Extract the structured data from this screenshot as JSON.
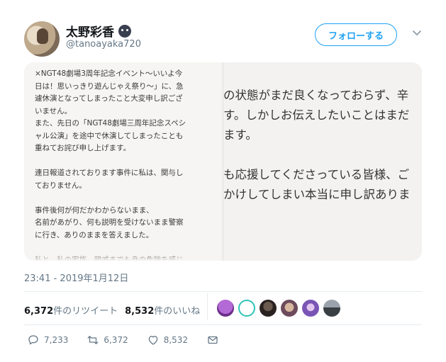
{
  "tweet": {
    "display_name": "太野彩香",
    "name_emoji_icon": "dark-mask-emoji",
    "handle": "@tanoayaka720",
    "follow_label": "フォローする",
    "timestamp": "23:41 - 2019年1月12日",
    "stats": {
      "retweets_count": "6,372",
      "retweets_label": "件のリツイート",
      "likes_count": "8,532",
      "likes_label": "件のいいね"
    },
    "actions": {
      "reply_count": "7,233",
      "retweet_count": "6,372",
      "like_count": "8,532"
    }
  },
  "media": {
    "left_lines": [
      "×NGT48劇場3周年記念イベント〜いいよ今",
      "日は！思いっきり遊んじゃえ祭り〜」に、急",
      "遽休演となってしまったこと大変申し訳ござ",
      "いません。",
      "また、先日の「NGT48劇場三周年記念スペシ",
      "ャル公演」を途中で休演してしまったことも",
      "重ねてお詫び申し上げます。",
      "",
      "連日報道されております事件に私は、関与し",
      "ておりません。",
      "",
      "事件後何が何だかわからないまま、",
      "名前があがり、何も説明を受けないまま警察",
      "に行き、ありのままを答えました。",
      "",
      "私と、私の家族、親戚までも身の危険を感じ"
    ],
    "right_lines": [
      "の状態がまだ良くなっておらず、辛",
      "す。しかしお伝えしたいことはまだ",
      "ます。",
      "",
      "も応援してくださっている皆様、ご",
      "かけしてしまい本当に申し訳ありま"
    ]
  },
  "colors": {
    "accent": "#1da1f2",
    "muted": "#657786",
    "text": "#14171a"
  },
  "likers": [
    "purple-slime-avatar",
    "cyan-cartoon-avatar",
    "dark-photo-avatar",
    "portrait-avatar",
    "purple-avatar",
    "gray-photo-avatar"
  ]
}
